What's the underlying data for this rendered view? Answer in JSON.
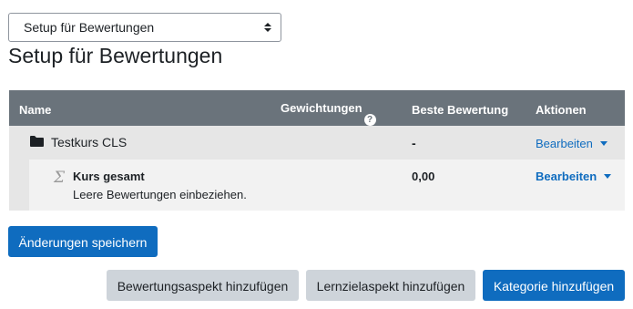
{
  "top_select": {
    "value": "Setup für Bewertungen"
  },
  "page_title": "Setup für Bewertungen",
  "table": {
    "headers": {
      "name": "Name",
      "weights": "Gewichtungen",
      "best_grade": "Beste Bewertung",
      "actions": "Aktionen"
    },
    "category_row": {
      "name": "Testkurs CLS",
      "best_grade": "-",
      "action": "Bearbeiten"
    },
    "total_row": {
      "name": "Kurs gesamt",
      "subtext": "Leere Bewertungen einbeziehen.",
      "best_grade": "0,00",
      "action": "Bearbeiten"
    }
  },
  "buttons": {
    "save": "Änderungen speichern",
    "add_grade_item": "Bewertungsaspekt hinzufügen",
    "add_outcome_item": "Lernzielaspekt hinzufügen",
    "add_category": "Kategorie hinzufügen"
  },
  "colors": {
    "header_bg": "#6a737b",
    "primary": "#0f6cbf",
    "secondary": "#ced4da"
  }
}
